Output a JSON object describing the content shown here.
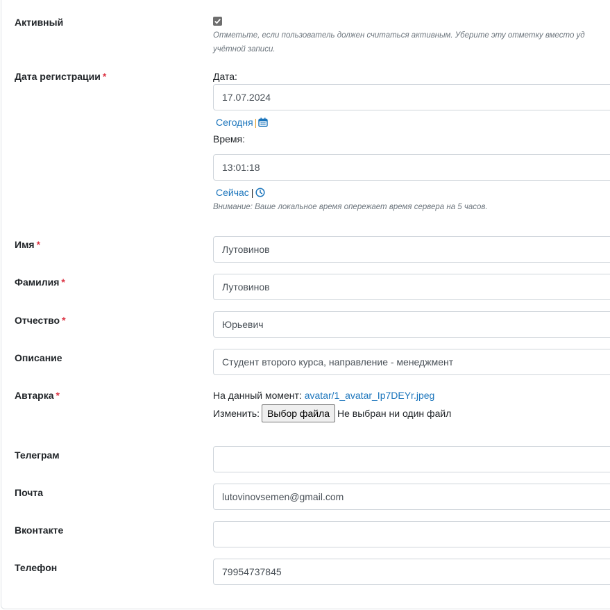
{
  "fields": {
    "active": {
      "label": "Активный",
      "checked": true,
      "help_line1": "Отметьте, если пользователь должен считаться активным. Уберите эту отметку вместо уд",
      "help_line2": "учётной записи."
    },
    "registration_date": {
      "label": "Дата регистрации",
      "required_mark": "*",
      "date_label": "Дата:",
      "date_value": "17.07.2024",
      "today_link": "Сегодня",
      "separator": "|",
      "time_label": "Время:",
      "time_value": "13:01:18",
      "now_link": "Сейчас",
      "note": "Внимание: Ваше локальное время опережает время сервера на 5 часов."
    },
    "first_name": {
      "label": "Имя",
      "required_mark": "*",
      "value": "Лутовинов"
    },
    "last_name": {
      "label": "Фамилия",
      "required_mark": "*",
      "value": "Лутовинов"
    },
    "patronymic": {
      "label": "Отчество",
      "required_mark": "*",
      "value": "Юрьевич"
    },
    "description": {
      "label": "Описание",
      "value": "Студент второго курса, направление - менеджмент"
    },
    "avatar": {
      "label": "Автарка",
      "required_mark": "*",
      "current_label": "На данный момент:",
      "current_file": "avatar/1_avatar_Ip7DEYr.jpeg",
      "change_label": "Изменить:",
      "choose_button": "Выбор файла",
      "no_file": "Не выбран ни один файл"
    },
    "telegram": {
      "label": "Телеграм",
      "value": ""
    },
    "email": {
      "label": "Почта",
      "value": "lutovinovsemen@gmail.com"
    },
    "vk": {
      "label": "Вконтакте",
      "value": ""
    },
    "phone": {
      "label": "Телефон",
      "value": "79954737845"
    }
  },
  "colors": {
    "link": "#1b75bc",
    "required": "#dc3545",
    "separator": "#e1a130"
  },
  "icons": {
    "calendar": "calendar-icon",
    "clock": "clock-icon"
  }
}
